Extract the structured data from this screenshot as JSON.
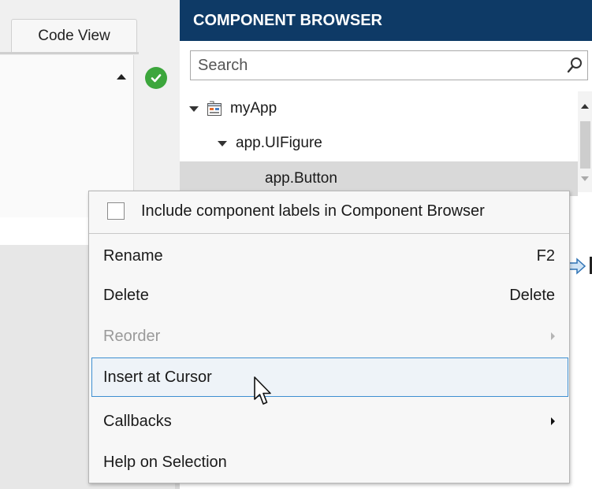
{
  "editor": {
    "tabs": {
      "code_view": "Code View"
    },
    "status": {
      "icon": "check-circle-icon",
      "color": "#3ca63c"
    }
  },
  "component_browser": {
    "title": "COMPONENT BROWSER",
    "header_color": "#0e3a66",
    "search": {
      "placeholder": "Search",
      "value": ""
    },
    "tree": [
      {
        "label": "myApp",
        "expanded": true,
        "icon": "app-icon"
      },
      {
        "label": "app.UIFigure",
        "expanded": true
      },
      {
        "label": "app.Button",
        "selected": true
      }
    ]
  },
  "context_menu": {
    "checkbox": {
      "label": "Include component labels in Component Browser",
      "checked": false
    },
    "items": [
      {
        "label": "Rename",
        "shortcut": "F2",
        "enabled": true
      },
      {
        "label": "Delete",
        "shortcut": "Delete",
        "enabled": true
      },
      {
        "label": "Reorder",
        "shortcut": "",
        "enabled": false,
        "submenu": true
      },
      {
        "label": "Insert at Cursor",
        "shortcut": "",
        "enabled": true,
        "highlighted": true
      },
      {
        "label": "Callbacks",
        "shortcut": "",
        "enabled": true,
        "submenu": true
      },
      {
        "label": "Help on Selection",
        "shortcut": "",
        "enabled": true
      }
    ],
    "highlight_color": "#3d8fd1"
  }
}
